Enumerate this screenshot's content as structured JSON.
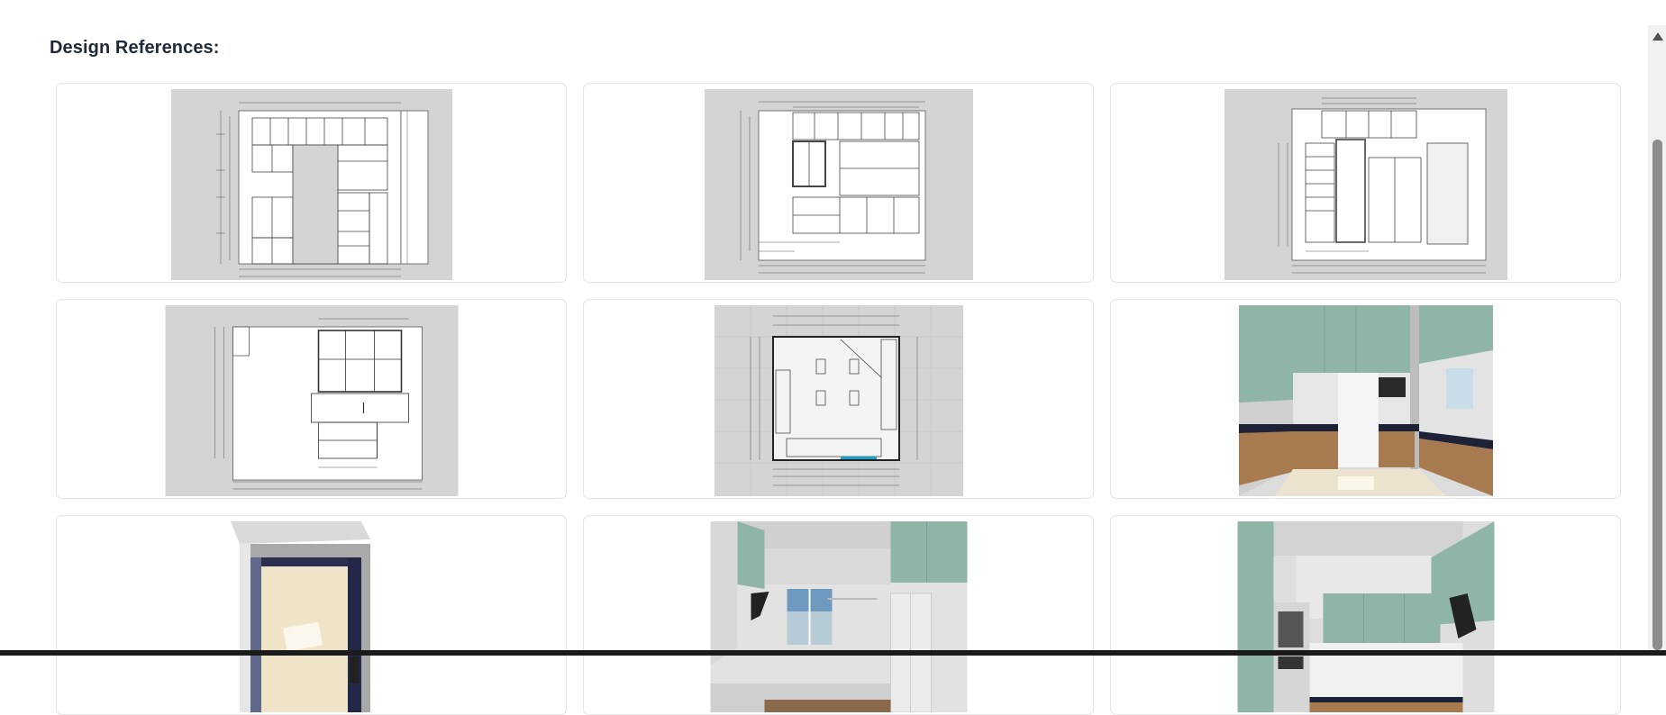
{
  "section": {
    "title": "Design References:"
  },
  "references": [
    {
      "kind": "elevation drawing"
    },
    {
      "kind": "elevation drawing"
    },
    {
      "kind": "elevation drawing"
    },
    {
      "kind": "elevation drawing"
    },
    {
      "kind": "floor plan drawing"
    },
    {
      "kind": "kitchen 3d render"
    },
    {
      "kind": "kitchen top view render"
    },
    {
      "kind": "kitchen 3d render"
    },
    {
      "kind": "kitchen 3d render"
    }
  ],
  "colors": {
    "drawing_bg": "#d4d4d4",
    "cabinet_green": "#8fb5a6",
    "wood": "#a87a4f",
    "countertop": "#1e2236",
    "floor": "#ece3cf",
    "heading": "#1f2937"
  }
}
